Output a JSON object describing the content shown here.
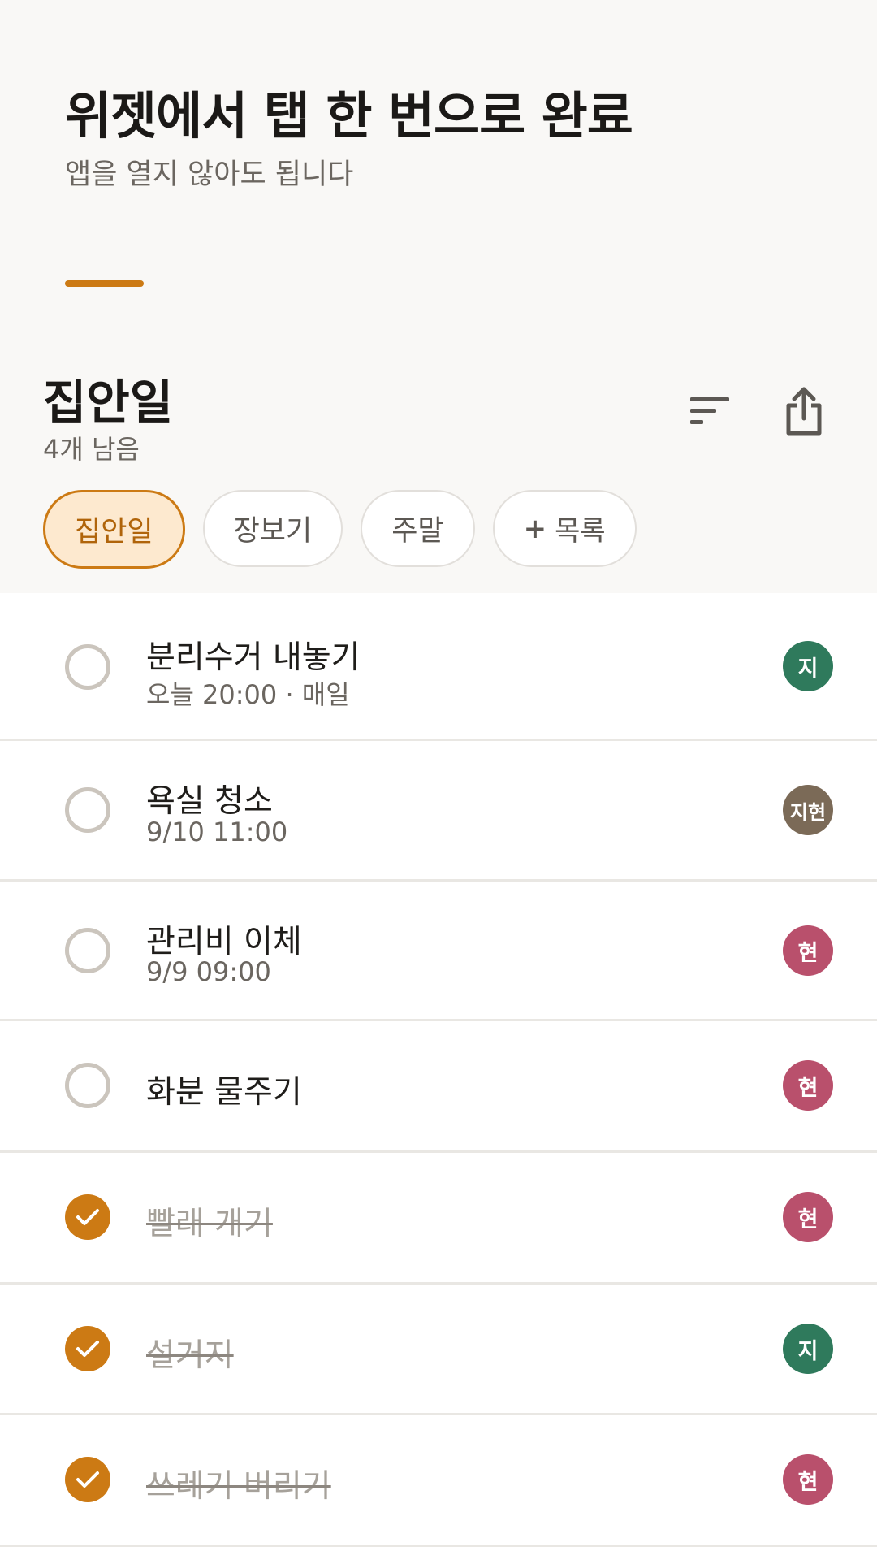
{
  "header": {
    "headline": "위젯에서 탭 한 번으로 완료",
    "subline": "앱을 열지 않아도 됩니다"
  },
  "list": {
    "title": "집안일",
    "remaining": "4개 남음",
    "sort_icon": "sort-icon",
    "share_icon": "share-icon"
  },
  "chips": [
    {
      "label": "집안일",
      "active": true
    },
    {
      "label": "장보기",
      "active": false
    },
    {
      "label": "주말",
      "active": false
    },
    {
      "plus": "+",
      "label": "목록",
      "active": false
    }
  ],
  "colors": {
    "accent": "#cc7a14",
    "avatar_ji": "#2f7a5c",
    "avatar_jihyeon": "#7b6a57",
    "avatar_hyeon": "#b9506c"
  },
  "tasks": [
    {
      "title": "분리수거 내놓기",
      "meta": "오늘 20:00 · 매일",
      "done": false,
      "assignee": "지"
    },
    {
      "title": "욕실 청소",
      "meta": "9/10 11:00",
      "done": false,
      "assignee": "지현"
    },
    {
      "title": "관리비 이체",
      "meta": "9/9 09:00",
      "done": false,
      "assignee": "현"
    },
    {
      "title": "화분 물주기",
      "meta": "",
      "done": false,
      "assignee": "현"
    },
    {
      "title": "빨래 개기",
      "meta": "",
      "done": true,
      "assignee": "현"
    },
    {
      "title": "설거지",
      "meta": "",
      "done": true,
      "assignee": "지"
    },
    {
      "title": "쓰레기 버리기",
      "meta": "",
      "done": true,
      "assignee": "현"
    }
  ]
}
